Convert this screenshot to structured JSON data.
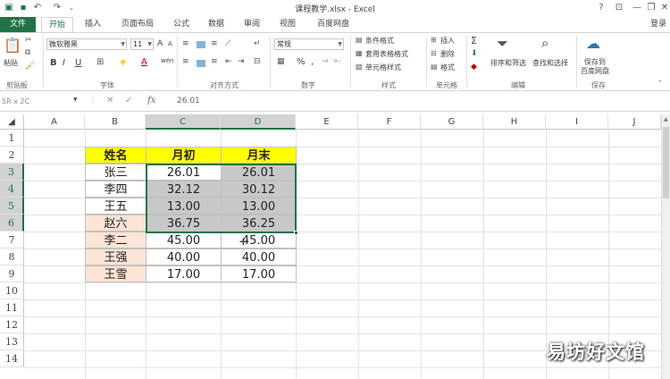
{
  "titlebar": {
    "title": "课程教学.xlsx - Excel",
    "help": "?",
    "ribbon_display": "⊡",
    "minimize": "—",
    "restore": "❐",
    "close": "✕"
  },
  "tabs": [
    {
      "label": "文件"
    },
    {
      "label": "开始"
    },
    {
      "label": "插入"
    },
    {
      "label": "页面布局"
    },
    {
      "label": "公式"
    },
    {
      "label": "数据"
    },
    {
      "label": "审阅"
    },
    {
      "label": "视图"
    },
    {
      "label": "百度网盘"
    }
  ],
  "account": {
    "login_label": "登录"
  },
  "ribbon": {
    "clipboard": {
      "paste": "粘贴",
      "label": "剪贴板"
    },
    "font": {
      "name": "微软雅黑",
      "size": "11",
      "label": "字体",
      "bold": "B",
      "italic": "I",
      "underline": "U",
      "grow": "A",
      "shrink": "A",
      "font_color": "A",
      "phonetic": "wén"
    },
    "alignment": {
      "label": "对齐方式"
    },
    "number": {
      "format": "常规",
      "label": "数字",
      "percent": "%",
      "comma": ","
    },
    "styles": {
      "conditional": "条件格式",
      "table": "套用表格格式",
      "cell": "单元格样式",
      "label": "样式"
    },
    "cells": {
      "insert": "插入",
      "delete": "删除",
      "format": "格式",
      "label": "单元格"
    },
    "editing": {
      "sort_filter": "排序和筛选",
      "find_select": "查找和选择",
      "label": "编辑",
      "sum": "Σ"
    },
    "save": {
      "line1": "保存到",
      "line2": "百度网盘",
      "label": "保存"
    }
  },
  "formula_bar": {
    "name_box": "5R x 2C",
    "fx": "fx",
    "cancel": "✕",
    "enter": "✓",
    "formula": "26.01"
  },
  "grid": {
    "columns": [
      "A",
      "B",
      "C",
      "D",
      "E",
      "F",
      "G",
      "H",
      "I",
      "J"
    ],
    "selected_columns": [
      "C",
      "D"
    ],
    "rows": [
      "1",
      "2",
      "3",
      "4",
      "5",
      "6",
      "7",
      "8",
      "9",
      "10",
      "11",
      "12",
      "13",
      "14"
    ],
    "selected_rows": [
      "3",
      "4",
      "5",
      "6"
    ],
    "table": {
      "headers": [
        "姓名",
        "月初",
        "月末"
      ],
      "rows": [
        {
          "name": "张三",
          "start": "26.01",
          "end": "26.01"
        },
        {
          "name": "李四",
          "start": "32.12",
          "end": "30.12"
        },
        {
          "name": "王五",
          "start": "13.00",
          "end": "13.00"
        },
        {
          "name": "赵六",
          "start": "36.75",
          "end": "36.25"
        },
        {
          "name": "李二",
          "start": "45.00",
          "end": "45.00"
        },
        {
          "name": "王强",
          "start": "40.00",
          "end": "40.00"
        },
        {
          "name": "王雪",
          "start": "17.00",
          "end": "17.00"
        }
      ]
    }
  },
  "colors": {
    "excel_green": "#217346",
    "header_yellow": "#ffff00",
    "name_peach": "#fce4d6",
    "selection_gray": "#c8c8c8"
  },
  "watermark": "易坊好文馆"
}
